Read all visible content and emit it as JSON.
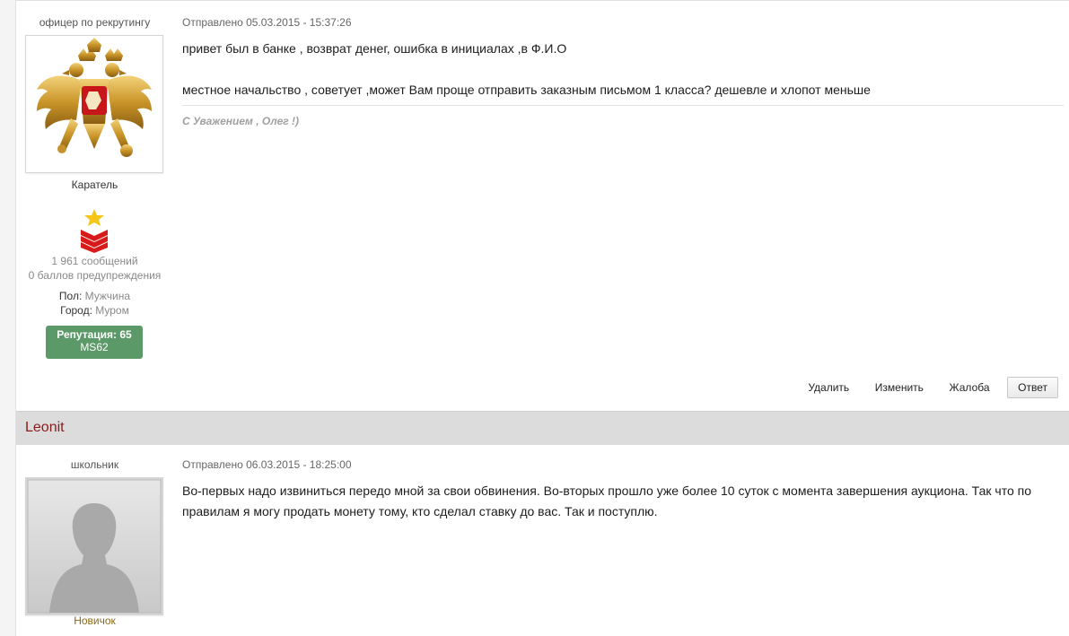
{
  "posts": [
    {
      "user_title": "офицер по рекрутингу",
      "avatar": "russian-coat-of-arms",
      "group": "Каратель",
      "rank_icon": "star-chevrons-icon",
      "posts_count": "1 961 сообщений",
      "warnings": "0 баллов предупреждения",
      "gender_label": "Пол:",
      "gender_value": "Мужчина",
      "city_label": "Город:",
      "city_value": "Муром",
      "reputation": "Репутация: 65",
      "rep_sub": "MS62",
      "date": "Отправлено 05.03.2015 - 15:37:26",
      "body_line1": "привет был в банке , возврат денег, ошибка в инициалах ,в Ф.И.О",
      "body_line2": "местное начальство , советует ,может Вам проще отправить заказным письмом 1 класса? дешевле и хлопот меньше",
      "signature": "С Уважением , Олег !)",
      "actions": {
        "delete": "Удалить",
        "edit": "Изменить",
        "report": "Жалоба",
        "reply": "Ответ"
      }
    },
    {
      "author": "Leonit",
      "user_title": "школьник",
      "avatar": "default-avatar-silhouette",
      "group": "Новичок",
      "date": "Отправлено 06.03.2015 - 18:25:00",
      "body_line1": "Во-первых надо извиниться передо мной за свои обвинения. Во-вторых прошло уже более 10 суток с момента завершения аукциона. Так что по",
      "body_line2": "правилам я могу продать монету тому, кто сделал ставку до вас. Так и поступлю."
    }
  ],
  "colors": {
    "author_name": "#8b1a1a",
    "rep_badge": "#5b9a68",
    "author_bar": "#dcdcdc"
  }
}
